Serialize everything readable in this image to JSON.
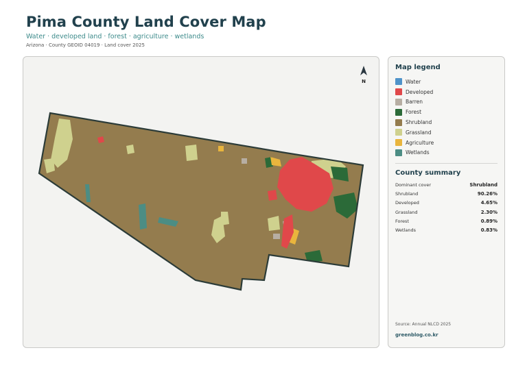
{
  "header": {
    "title": "Pima County Land Cover Map",
    "subtitle": "Water · developed land · forest · agriculture · wetlands",
    "meta": "Arizona · County GEOID 04019 · Land cover 2025"
  },
  "map": {
    "north_label": "N",
    "colors": {
      "shrubland": "#947c4e",
      "developed": "#e0484a",
      "forest": "#2b6a38",
      "grassland": "#cfd18e",
      "agriculture": "#e9b53d",
      "wetlands": "#4c8d84",
      "barren": "#b7aea3",
      "water": "#4f93c9",
      "outline": "#2b3b38"
    }
  },
  "legend": {
    "heading": "Map legend",
    "items": [
      {
        "label": "Water",
        "color": "#4f93c9"
      },
      {
        "label": "Developed",
        "color": "#e0484a"
      },
      {
        "label": "Barren",
        "color": "#b7aea3"
      },
      {
        "label": "Forest",
        "color": "#2b6a38"
      },
      {
        "label": "Shrubland",
        "color": "#947c4e"
      },
      {
        "label": "Grassland",
        "color": "#cfd18e"
      },
      {
        "label": "Agriculture",
        "color": "#e9b53d"
      },
      {
        "label": "Wetlands",
        "color": "#4c8d84"
      }
    ]
  },
  "summary": {
    "heading": "County summary",
    "rows": [
      {
        "key": "Dominant cover",
        "value": "Shrubland"
      },
      {
        "key": "Shrubland",
        "value": "90.26%"
      },
      {
        "key": "Developed",
        "value": "4.65%"
      },
      {
        "key": "Grassland",
        "value": "2.30%"
      },
      {
        "key": "Forest",
        "value": "0.89%"
      },
      {
        "key": "Wetlands",
        "value": "0.83%"
      }
    ]
  },
  "footer": {
    "source": "Source: Annual NLCD 2025",
    "credit": "greenblog.co.kr"
  }
}
